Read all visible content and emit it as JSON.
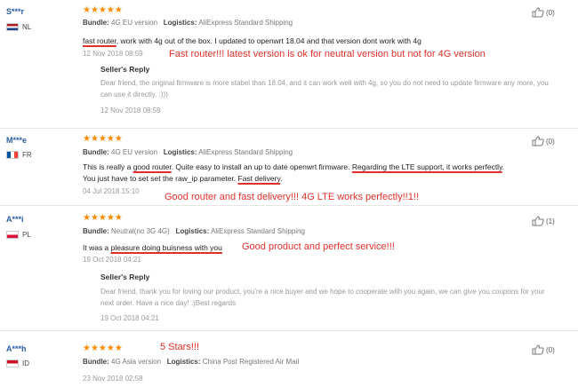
{
  "reviews": [
    {
      "user": "S***r",
      "country": "NL",
      "flag_colors": [
        "#ae1c28",
        "#ffffff",
        "#21468b"
      ],
      "stars": "★★★★★",
      "bundle_label": "Bundle:",
      "bundle": "4G EU version",
      "logistics_label": "Logistics:",
      "logistics": "AliExpress Standard Shipping",
      "text_parts": [
        "fast router",
        ", work with 4g out of the box. I updated to openwrt 18.04 and that version dont work with 4g"
      ],
      "date": "12 Nov 2018 08:59",
      "annotation": "Fast router!!! latest version is ok for neutral version but not for 4G version",
      "seller_reply_title": "Seller's Reply",
      "seller_reply": "Dear friend, the original firmware is more stabel than 18.04, and it can work well with 4g, so you do not need to update firmware any more, you can use it directly. :)))",
      "seller_reply_date": "12 Nov 2018 08:59",
      "helpful": "(0)"
    },
    {
      "user": "M***e",
      "country": "FR",
      "flag_colors": [
        "#0055a4",
        "#ffffff",
        "#ef4135"
      ],
      "stars": "★★★★★",
      "bundle_label": "Bundle:",
      "bundle": "4G EU version",
      "logistics_label": "Logistics:",
      "logistics": "AliExpress Standard Shipping",
      "text_line1_parts": [
        "This is really a ",
        "good router",
        ". Quite easy to install an up to date openwrt firmware. ",
        "Regarding the LTE support, it works perfectly",
        "."
      ],
      "text_line2_parts": [
        "You just have to set set the raw_ip parameter. ",
        "Fast delivery",
        "."
      ],
      "date": "04 Jul 2018 15:10",
      "annotation": "Good router and fast delivery!!! 4G LTE works perfectly!!1!!",
      "helpful": "(0)"
    },
    {
      "user": "A***i",
      "country": "PL",
      "flag_colors": [
        "#ffffff",
        "#dc143c"
      ],
      "stars": "★★★★★",
      "bundle_label": "Bundle:",
      "bundle": "Neutral(no 3G 4G)",
      "logistics_label": "Logistics:",
      "logistics": "AliExpress Standard Shipping",
      "text_parts": [
        "It was a ",
        "pleasure doing buisness with you"
      ],
      "date": "19 Oct 2018 04:21",
      "annotation": "Good product and perfect service!!!",
      "seller_reply_title": "Seller's Reply",
      "seller_reply": "Dear friend, thank you for loving our product, you're a nice buyer and we hope to cooperate with you again, we can give you coupons for your next order. Have a nice day! :)Best regards",
      "seller_reply_date": "19 Oct 2018 04:21",
      "helpful": "(1)"
    },
    {
      "user": "A***h",
      "country": "ID",
      "flag_colors": [
        "#ce1126",
        "#ffffff"
      ],
      "stars": "★★★★★",
      "bundle_label": "Bundle:",
      "bundle": "4G Asia version",
      "logistics_label": "Logistics:",
      "logistics": "China Post Registered Air Mail",
      "date": "23 Nov 2018 02:58",
      "annotation": "5 Stars!!!",
      "helpful": "(0)"
    }
  ],
  "colors": {
    "accent_star": "#ff8a00",
    "annotation": "#e0302a",
    "username": "#2a5ea7"
  },
  "icons": {
    "helpful": "thumbs-up-icon"
  }
}
